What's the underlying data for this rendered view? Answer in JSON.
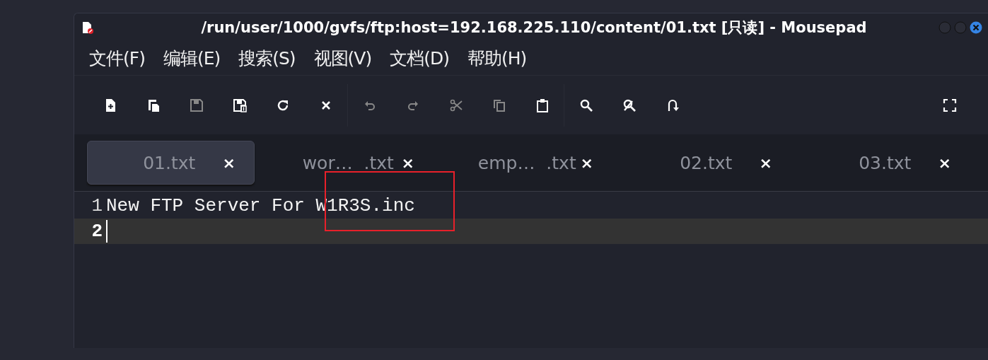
{
  "window": {
    "title": "/run/user/1000/gvfs/ftp:host=192.168.225.110/content/01.txt [只读] - Mousepad"
  },
  "menu": [
    "文件(F)",
    "编辑(E)",
    "搜索(S)",
    "视图(V)",
    "文档(D)",
    "帮助(H)"
  ],
  "toolbar": {
    "groups": [
      [
        {
          "disabled": false
        },
        {
          "disabled": false
        },
        {
          "disabled": true
        },
        {
          "disabled": false
        },
        {
          "disabled": false
        },
        {
          "disabled": false
        }
      ],
      [
        {
          "disabled": true
        },
        {
          "disabled": true
        },
        {
          "disabled": true
        },
        {
          "disabled": true
        },
        {
          "disabled": false
        }
      ],
      [
        {
          "disabled": false
        },
        {
          "disabled": false
        },
        {
          "disabled": false
        }
      ],
      [
        {
          "disabled": false
        }
      ]
    ]
  },
  "tabs": [
    {
      "label": "01.txt",
      "close": "×",
      "selected": true
    },
    {
      "label": "wor…  .txt",
      "close": "×",
      "selected": false
    },
    {
      "label": "emp…  .txt",
      "close": "×",
      "selected": false
    },
    {
      "label": "02.txt",
      "close": "×",
      "selected": false
    },
    {
      "label": "03.txt",
      "close": "×",
      "selected": false
    }
  ],
  "editor": {
    "lines": [
      {
        "number": "1",
        "text": "New FTP Server For W1R3S.inc",
        "current": false
      },
      {
        "number": "2",
        "current": true
      }
    ]
  }
}
